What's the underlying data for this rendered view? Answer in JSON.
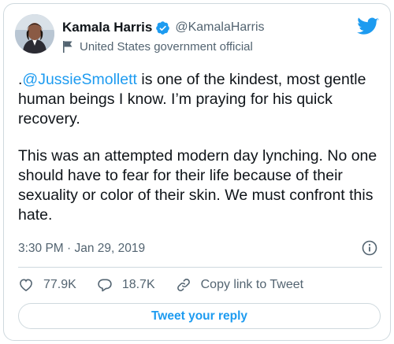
{
  "author": {
    "display_name": "Kamala Harris",
    "handle": "@KamalaHarris",
    "label": "United States government official",
    "avatar": "profile-photo"
  },
  "tweet": {
    "mention": "@JussieSmollett",
    "paragraph1_prefix": ".",
    "paragraph1_rest": " is one of the kindest, most gentle human beings I know. I’m praying for his quick recovery.",
    "paragraph2": "This was an attempted modern day lynching. No one should have to fear for their life because of their sexuality or color of their skin. We must confront this hate."
  },
  "meta": {
    "timestamp": "3:30 PM · Jan 29, 2019"
  },
  "actions": {
    "likes": "77.9K",
    "replies": "18.7K",
    "copy_link": "Copy link to Tweet"
  },
  "reply_button": "Tweet your reply",
  "colors": {
    "accent": "#1d9bf0",
    "text": "#0f1419",
    "muted": "#536471",
    "border": "#cfd9de"
  },
  "icons": [
    "verified-badge-icon",
    "government-flag-icon",
    "twitter-bird-icon",
    "info-icon",
    "heart-icon",
    "reply-bubble-icon",
    "link-icon"
  ]
}
